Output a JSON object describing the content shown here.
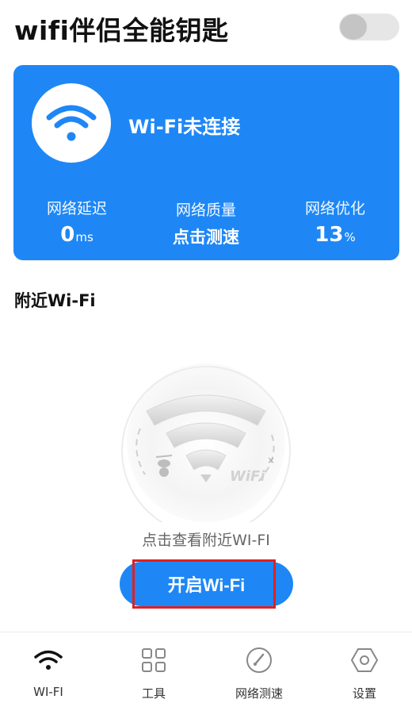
{
  "header": {
    "title": "wifi伴侣全能钥匙"
  },
  "status_card": {
    "status_text": "Wi-Fi未连接",
    "stats": [
      {
        "label": "网络延迟",
        "value": "0",
        "unit": "ms"
      },
      {
        "label": "网络质量",
        "value": "点击测速",
        "unit": ""
      },
      {
        "label": "网络优化",
        "value": "13",
        "unit": "%"
      }
    ]
  },
  "nearby": {
    "section_title": "附近Wi-Fi",
    "illustration_text": "WiFi",
    "hint": "点击查看附近WI-FI",
    "button_label": "开启Wi-Fi"
  },
  "tabbar": {
    "items": [
      {
        "label": "WI-FI",
        "icon": "wifi-icon"
      },
      {
        "label": "工具",
        "icon": "grid-icon"
      },
      {
        "label": "网络测速",
        "icon": "speedometer-icon"
      },
      {
        "label": "设置",
        "icon": "gear-icon"
      }
    ]
  },
  "colors": {
    "primary": "#1e87f5",
    "highlight": "#e02020"
  }
}
